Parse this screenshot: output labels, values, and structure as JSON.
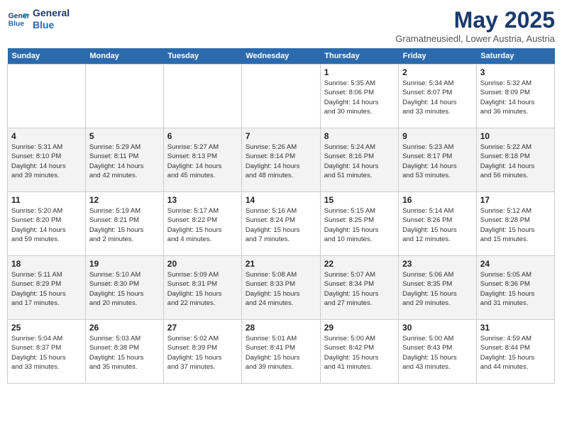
{
  "header": {
    "logo_line1": "General",
    "logo_line2": "Blue",
    "month": "May 2025",
    "location": "Gramatneusiedl, Lower Austria, Austria"
  },
  "days_of_week": [
    "Sunday",
    "Monday",
    "Tuesday",
    "Wednesday",
    "Thursday",
    "Friday",
    "Saturday"
  ],
  "weeks": [
    [
      {
        "day": "",
        "info": ""
      },
      {
        "day": "",
        "info": ""
      },
      {
        "day": "",
        "info": ""
      },
      {
        "day": "",
        "info": ""
      },
      {
        "day": "1",
        "info": "Sunrise: 5:35 AM\nSunset: 8:06 PM\nDaylight: 14 hours\nand 30 minutes."
      },
      {
        "day": "2",
        "info": "Sunrise: 5:34 AM\nSunset: 8:07 PM\nDaylight: 14 hours\nand 33 minutes."
      },
      {
        "day": "3",
        "info": "Sunrise: 5:32 AM\nSunset: 8:09 PM\nDaylight: 14 hours\nand 36 minutes."
      }
    ],
    [
      {
        "day": "4",
        "info": "Sunrise: 5:31 AM\nSunset: 8:10 PM\nDaylight: 14 hours\nand 39 minutes."
      },
      {
        "day": "5",
        "info": "Sunrise: 5:29 AM\nSunset: 8:11 PM\nDaylight: 14 hours\nand 42 minutes."
      },
      {
        "day": "6",
        "info": "Sunrise: 5:27 AM\nSunset: 8:13 PM\nDaylight: 14 hours\nand 45 minutes."
      },
      {
        "day": "7",
        "info": "Sunrise: 5:26 AM\nSunset: 8:14 PM\nDaylight: 14 hours\nand 48 minutes."
      },
      {
        "day": "8",
        "info": "Sunrise: 5:24 AM\nSunset: 8:16 PM\nDaylight: 14 hours\nand 51 minutes."
      },
      {
        "day": "9",
        "info": "Sunrise: 5:23 AM\nSunset: 8:17 PM\nDaylight: 14 hours\nand 53 minutes."
      },
      {
        "day": "10",
        "info": "Sunrise: 5:22 AM\nSunset: 8:18 PM\nDaylight: 14 hours\nand 56 minutes."
      }
    ],
    [
      {
        "day": "11",
        "info": "Sunrise: 5:20 AM\nSunset: 8:20 PM\nDaylight: 14 hours\nand 59 minutes."
      },
      {
        "day": "12",
        "info": "Sunrise: 5:19 AM\nSunset: 8:21 PM\nDaylight: 15 hours\nand 2 minutes."
      },
      {
        "day": "13",
        "info": "Sunrise: 5:17 AM\nSunset: 8:22 PM\nDaylight: 15 hours\nand 4 minutes."
      },
      {
        "day": "14",
        "info": "Sunrise: 5:16 AM\nSunset: 8:24 PM\nDaylight: 15 hours\nand 7 minutes."
      },
      {
        "day": "15",
        "info": "Sunrise: 5:15 AM\nSunset: 8:25 PM\nDaylight: 15 hours\nand 10 minutes."
      },
      {
        "day": "16",
        "info": "Sunrise: 5:14 AM\nSunset: 8:26 PM\nDaylight: 15 hours\nand 12 minutes."
      },
      {
        "day": "17",
        "info": "Sunrise: 5:12 AM\nSunset: 8:28 PM\nDaylight: 15 hours\nand 15 minutes."
      }
    ],
    [
      {
        "day": "18",
        "info": "Sunrise: 5:11 AM\nSunset: 8:29 PM\nDaylight: 15 hours\nand 17 minutes."
      },
      {
        "day": "19",
        "info": "Sunrise: 5:10 AM\nSunset: 8:30 PM\nDaylight: 15 hours\nand 20 minutes."
      },
      {
        "day": "20",
        "info": "Sunrise: 5:09 AM\nSunset: 8:31 PM\nDaylight: 15 hours\nand 22 minutes."
      },
      {
        "day": "21",
        "info": "Sunrise: 5:08 AM\nSunset: 8:33 PM\nDaylight: 15 hours\nand 24 minutes."
      },
      {
        "day": "22",
        "info": "Sunrise: 5:07 AM\nSunset: 8:34 PM\nDaylight: 15 hours\nand 27 minutes."
      },
      {
        "day": "23",
        "info": "Sunrise: 5:06 AM\nSunset: 8:35 PM\nDaylight: 15 hours\nand 29 minutes."
      },
      {
        "day": "24",
        "info": "Sunrise: 5:05 AM\nSunset: 8:36 PM\nDaylight: 15 hours\nand 31 minutes."
      }
    ],
    [
      {
        "day": "25",
        "info": "Sunrise: 5:04 AM\nSunset: 8:37 PM\nDaylight: 15 hours\nand 33 minutes."
      },
      {
        "day": "26",
        "info": "Sunrise: 5:03 AM\nSunset: 8:38 PM\nDaylight: 15 hours\nand 35 minutes."
      },
      {
        "day": "27",
        "info": "Sunrise: 5:02 AM\nSunset: 8:39 PM\nDaylight: 15 hours\nand 37 minutes."
      },
      {
        "day": "28",
        "info": "Sunrise: 5:01 AM\nSunset: 8:41 PM\nDaylight: 15 hours\nand 39 minutes."
      },
      {
        "day": "29",
        "info": "Sunrise: 5:00 AM\nSunset: 8:42 PM\nDaylight: 15 hours\nand 41 minutes."
      },
      {
        "day": "30",
        "info": "Sunrise: 5:00 AM\nSunset: 8:43 PM\nDaylight: 15 hours\nand 43 minutes."
      },
      {
        "day": "31",
        "info": "Sunrise: 4:59 AM\nSunset: 8:44 PM\nDaylight: 15 hours\nand 44 minutes."
      }
    ]
  ]
}
